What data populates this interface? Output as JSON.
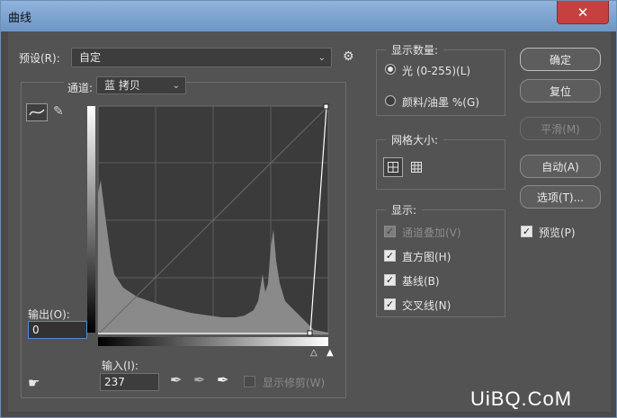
{
  "window": {
    "title": "曲线",
    "close_symbol": "✕"
  },
  "preset": {
    "label": "预设(R):",
    "value": "自定"
  },
  "channel": {
    "label": "通道:",
    "value": "蓝 拷贝"
  },
  "output": {
    "label": "输出(O):",
    "value": "0"
  },
  "input": {
    "label": "输入(I):",
    "value": "237"
  },
  "show_clipping": {
    "label": "显示修剪(W)",
    "checked": false,
    "enabled": false
  },
  "display_amount": {
    "title": "显示数量:",
    "options": [
      {
        "label": "光 (0-255)(L)",
        "selected": true
      },
      {
        "label": "颜料/油墨 %(G)",
        "selected": false
      }
    ]
  },
  "grid_size": {
    "title": "网格大小:"
  },
  "display": {
    "title": "显示:",
    "options": [
      {
        "label": "通道叠加(V)",
        "checked": true,
        "enabled": false
      },
      {
        "label": "直方图(H)",
        "checked": true,
        "enabled": true
      },
      {
        "label": "基线(B)",
        "checked": true,
        "enabled": true
      },
      {
        "label": "交叉线(N)",
        "checked": true,
        "enabled": true
      }
    ]
  },
  "buttons": {
    "ok": "确定",
    "reset": "复位",
    "smooth": "平滑(M)",
    "auto": "自动(A)",
    "options": "选项(T)..."
  },
  "preview": {
    "label": "预览(P)",
    "checked": true
  },
  "watermark": "UiBQ.CoM"
}
